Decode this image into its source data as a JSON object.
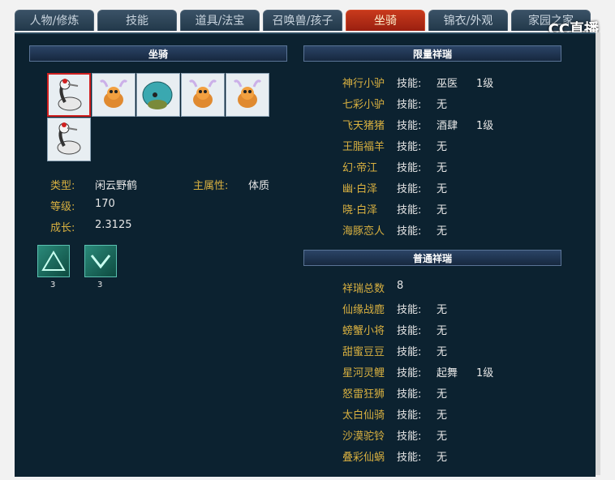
{
  "tabs": [
    {
      "label": "人物/修炼"
    },
    {
      "label": "技能"
    },
    {
      "label": "道具/法宝"
    },
    {
      "label": "召唤兽/孩子"
    },
    {
      "label": "坐骑"
    },
    {
      "label": "锦衣/外观"
    },
    {
      "label": "家园之家"
    }
  ],
  "active_tab": 4,
  "logo": "CC直播",
  "left": {
    "header": "坐骑",
    "mounts": [
      "crane",
      "deer",
      "turtle",
      "deer",
      "deer",
      "crane"
    ],
    "selected_index": 0,
    "info": {
      "type_label": "类型:",
      "type_value": "闲云野鹤",
      "main_attr_label": "主属性:",
      "main_attr_value": "体质",
      "level_label": "等级:",
      "level_value": "170",
      "growth_label": "成长:",
      "growth_value": "2.3125"
    },
    "skills": [
      {
        "icon": "mount-skill-icon-1",
        "level": "3"
      },
      {
        "icon": "mount-skill-icon-2",
        "level": "3"
      }
    ]
  },
  "limited": {
    "header": "限量祥瑞",
    "items": [
      {
        "name": "神行小驴",
        "skill_label": "技能:",
        "skill": "巫医",
        "level": "1级"
      },
      {
        "name": "七彩小驴",
        "skill_label": "技能:",
        "skill": "无",
        "level": ""
      },
      {
        "name": "飞天猪猪",
        "skill_label": "技能:",
        "skill": "酒肆",
        "level": "1级"
      },
      {
        "name": "王脂福羊",
        "skill_label": "技能:",
        "skill": "无",
        "level": ""
      },
      {
        "name": "幻·帝江",
        "skill_label": "技能:",
        "skill": "无",
        "level": ""
      },
      {
        "name": "幽·白泽",
        "skill_label": "技能:",
        "skill": "无",
        "level": ""
      },
      {
        "name": "晓·白泽",
        "skill_label": "技能:",
        "skill": "无",
        "level": ""
      },
      {
        "name": "海豚恋人",
        "skill_label": "技能:",
        "skill": "无",
        "level": ""
      }
    ]
  },
  "normal": {
    "header": "普通祥瑞",
    "total_label": "祥瑞总数",
    "total_value": "8",
    "items": [
      {
        "name": "仙缘战鹿",
        "skill_label": "技能:",
        "skill": "无",
        "level": ""
      },
      {
        "name": "螃蟹小将",
        "skill_label": "技能:",
        "skill": "无",
        "level": ""
      },
      {
        "name": "甜蜜豆豆",
        "skill_label": "技能:",
        "skill": "无",
        "level": ""
      },
      {
        "name": "星河灵鲤",
        "skill_label": "技能:",
        "skill": "起舞",
        "level": "1级"
      },
      {
        "name": "怒雷狂狮",
        "skill_label": "技能:",
        "skill": "无",
        "level": ""
      },
      {
        "name": "太白仙骑",
        "skill_label": "技能:",
        "skill": "无",
        "level": ""
      },
      {
        "name": "沙漠驼铃",
        "skill_label": "技能:",
        "skill": "无",
        "level": ""
      },
      {
        "name": "叠彩仙蜗",
        "skill_label": "技能:",
        "skill": "无",
        "level": ""
      }
    ]
  }
}
